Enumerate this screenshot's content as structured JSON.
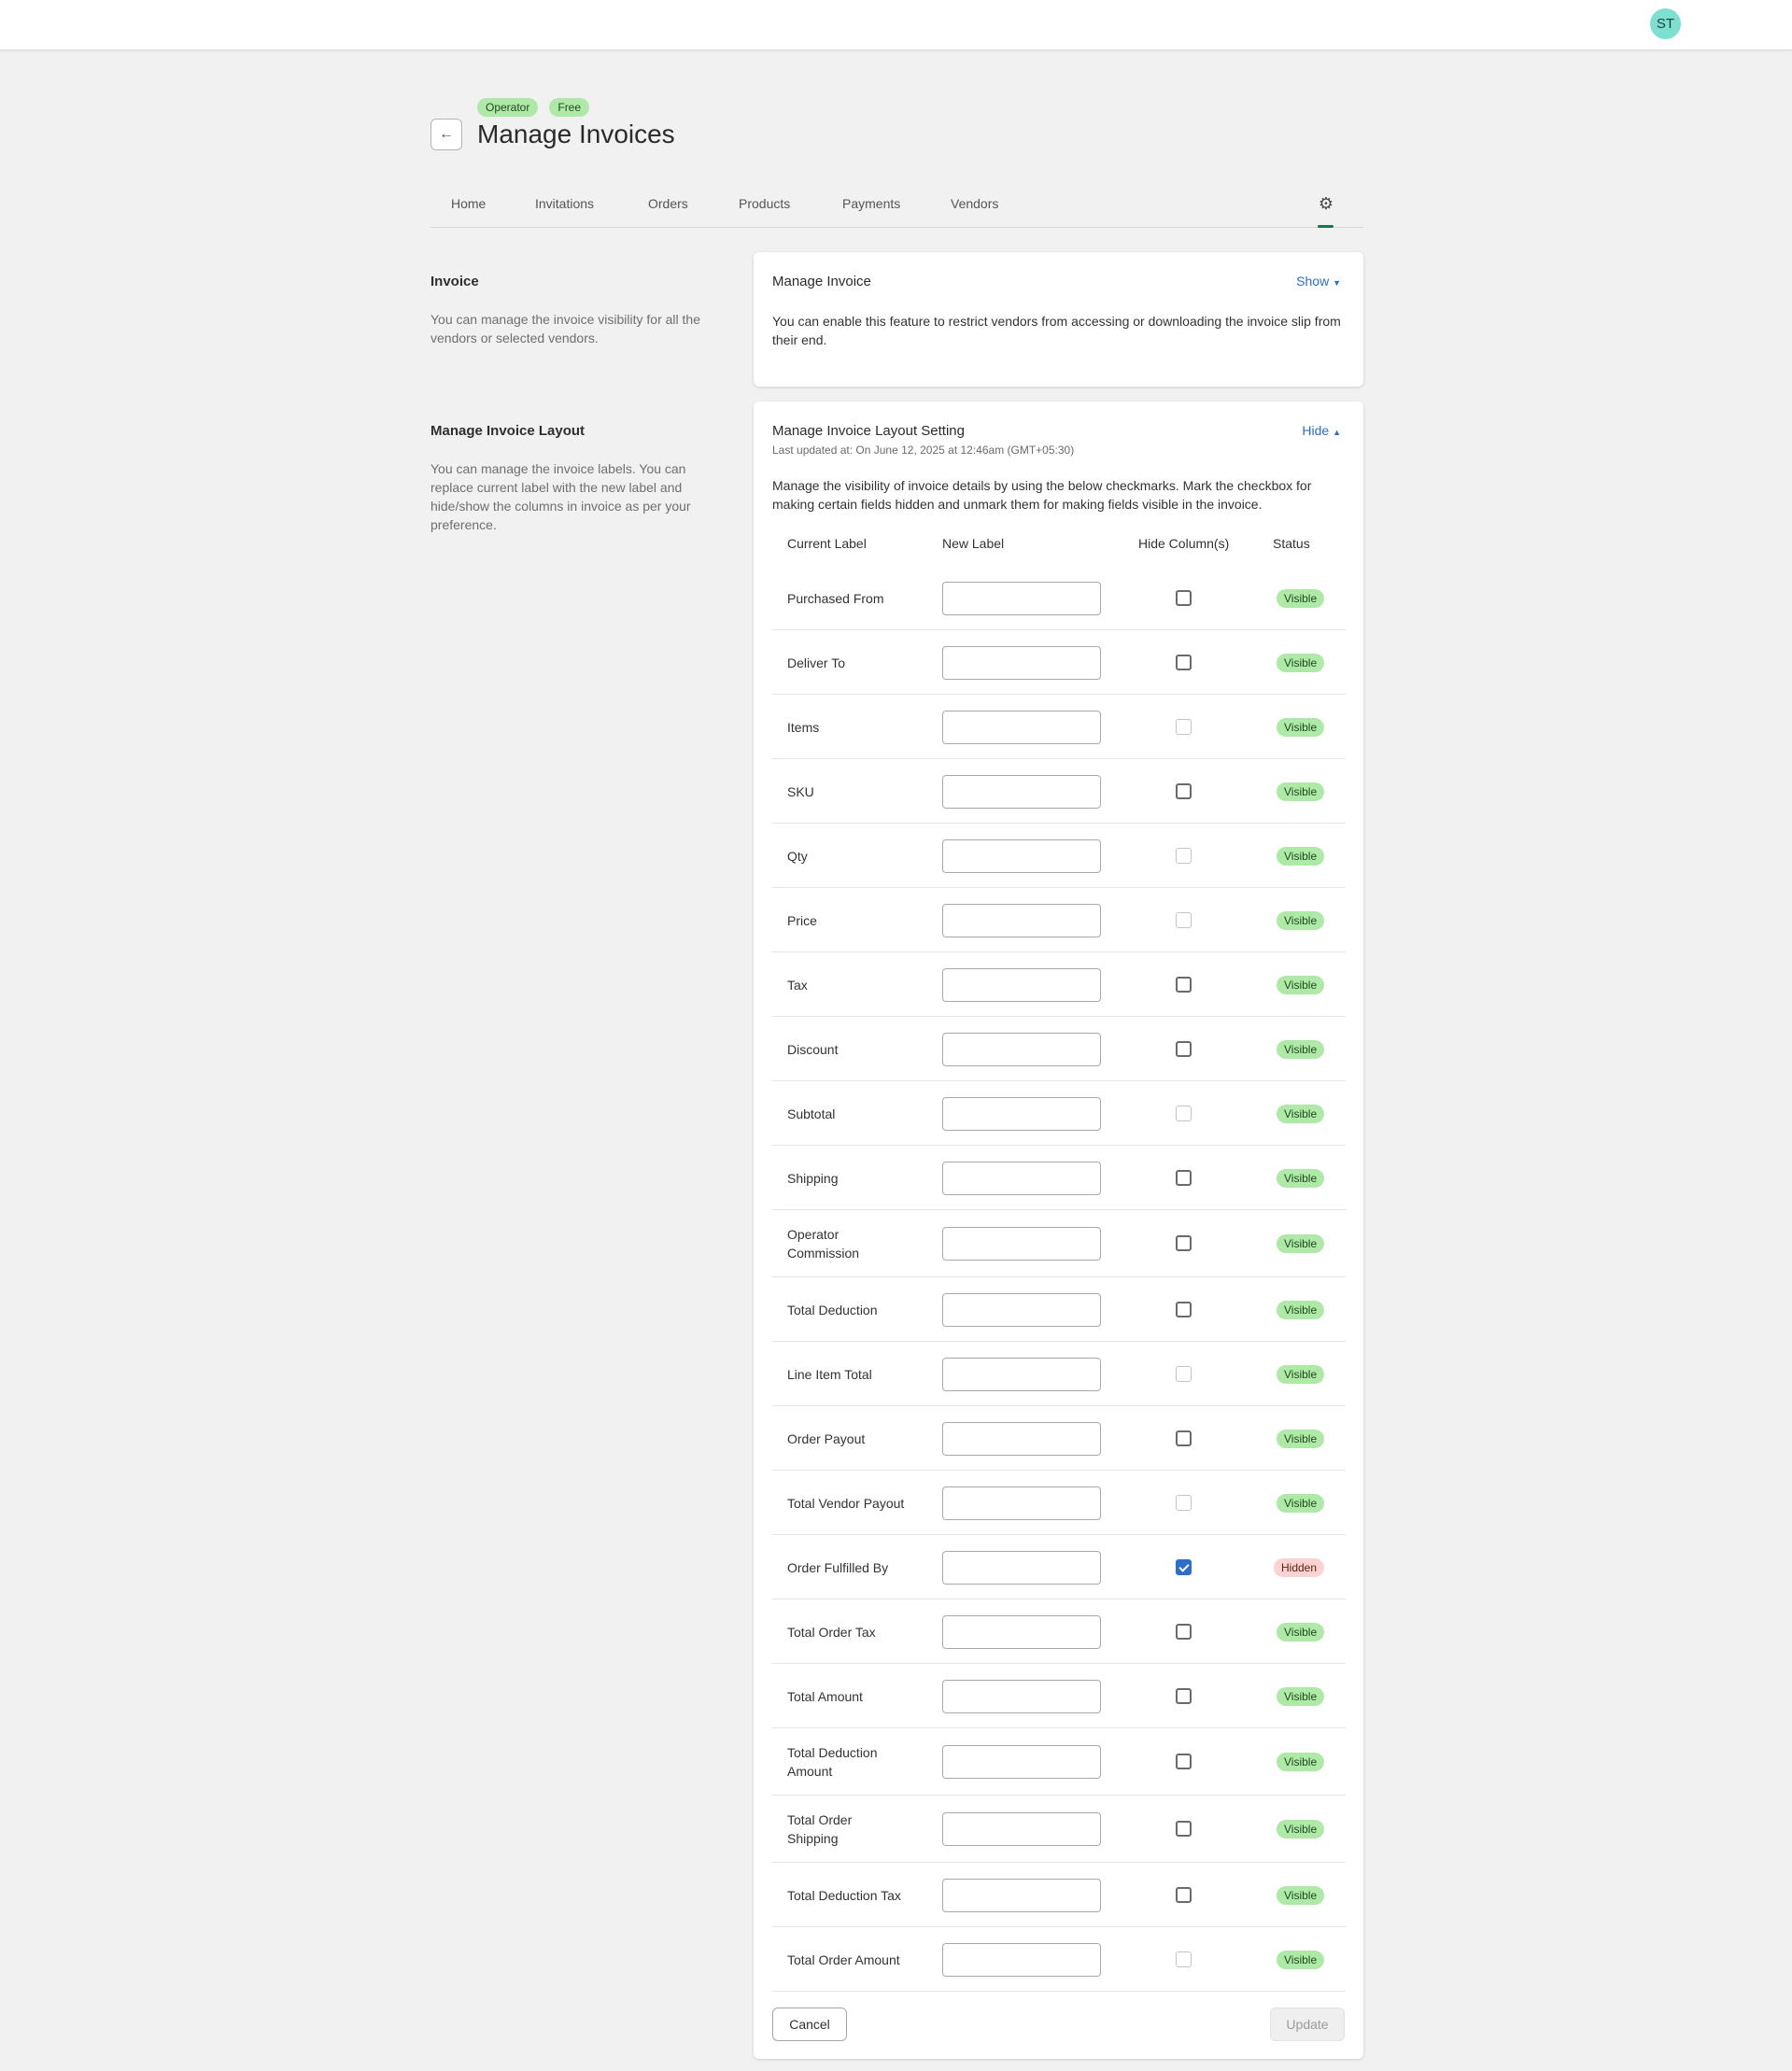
{
  "header": {
    "avatar_initials": "ST"
  },
  "page": {
    "badges": [
      "Operator",
      "Free"
    ],
    "title": "Manage Invoices"
  },
  "tabs": [
    "Home",
    "Invitations",
    "Orders",
    "Products",
    "Payments",
    "Vendors"
  ],
  "invoice_section": {
    "title": "Invoice",
    "description": "You can manage the invoice visibility for all the vendors or selected vendors.",
    "card_title": "Manage Invoice",
    "toggle_label": "Show",
    "card_text": "You can enable this feature to restrict vendors from accessing or downloading the invoice slip from their end."
  },
  "layout_section": {
    "title": "Manage Invoice Layout",
    "description": "You can manage the invoice labels. You can replace current label with the new label and hide/show the columns in invoice as per your preference.",
    "card_title": "Manage Invoice Layout Setting",
    "toggle_label": "Hide",
    "last_updated": "Last updated at: On June 12, 2025 at 12:46am (GMT+05:30)",
    "instructions": "Manage the visibility of invoice details by using the below checkmarks. Mark the checkbox for making certain fields hidden and unmark them for making fields visible in the invoice.",
    "columns": [
      "Current Label",
      "New Label",
      "Hide Column(s)",
      "Status"
    ],
    "rows": [
      {
        "label": "Purchased From",
        "new_label": "",
        "hide": false,
        "disabled": false,
        "status": "Visible"
      },
      {
        "label": "Deliver To",
        "new_label": "",
        "hide": false,
        "disabled": false,
        "status": "Visible"
      },
      {
        "label": "Items",
        "new_label": "",
        "hide": false,
        "disabled": true,
        "status": "Visible"
      },
      {
        "label": "SKU",
        "new_label": "",
        "hide": false,
        "disabled": false,
        "status": "Visible"
      },
      {
        "label": "Qty",
        "new_label": "",
        "hide": false,
        "disabled": true,
        "status": "Visible"
      },
      {
        "label": "Price",
        "new_label": "",
        "hide": false,
        "disabled": true,
        "status": "Visible"
      },
      {
        "label": "Tax",
        "new_label": "",
        "hide": false,
        "disabled": false,
        "status": "Visible"
      },
      {
        "label": "Discount",
        "new_label": "",
        "hide": false,
        "disabled": false,
        "status": "Visible"
      },
      {
        "label": "Subtotal",
        "new_label": "",
        "hide": false,
        "disabled": true,
        "status": "Visible"
      },
      {
        "label": "Shipping",
        "new_label": "",
        "hide": false,
        "disabled": false,
        "status": "Visible"
      },
      {
        "label": "Operator Commission",
        "new_label": "",
        "hide": false,
        "disabled": false,
        "status": "Visible"
      },
      {
        "label": "Total Deduction",
        "new_label": "",
        "hide": false,
        "disabled": false,
        "status": "Visible"
      },
      {
        "label": "Line Item Total",
        "new_label": "",
        "hide": false,
        "disabled": true,
        "status": "Visible"
      },
      {
        "label": "Order Payout",
        "new_label": "",
        "hide": false,
        "disabled": false,
        "status": "Visible"
      },
      {
        "label": "Total Vendor Payout",
        "new_label": "",
        "hide": false,
        "disabled": true,
        "status": "Visible"
      },
      {
        "label": "Order Fulfilled By",
        "new_label": "",
        "hide": true,
        "disabled": false,
        "status": "Hidden"
      },
      {
        "label": "Total Order Tax",
        "new_label": "",
        "hide": false,
        "disabled": false,
        "status": "Visible"
      },
      {
        "label": "Total Amount",
        "new_label": "",
        "hide": false,
        "disabled": false,
        "status": "Visible"
      },
      {
        "label": "Total Deduction Amount",
        "new_label": "",
        "hide": false,
        "disabled": false,
        "status": "Visible"
      },
      {
        "label": "Total Order Shipping",
        "new_label": "",
        "hide": false,
        "disabled": false,
        "status": "Visible"
      },
      {
        "label": "Total Deduction Tax",
        "new_label": "",
        "hide": false,
        "disabled": false,
        "status": "Visible"
      },
      {
        "label": "Total Order Amount",
        "new_label": "",
        "hide": false,
        "disabled": true,
        "status": "Visible"
      }
    ],
    "cancel_label": "Cancel",
    "update_label": "Update"
  }
}
